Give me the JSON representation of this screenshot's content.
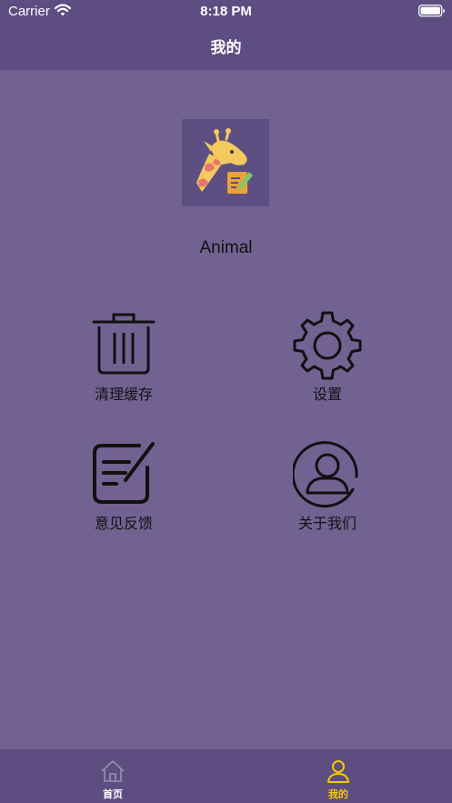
{
  "status_bar": {
    "carrier": "Carrier",
    "time": "8:18 PM"
  },
  "nav": {
    "title": "我的"
  },
  "profile": {
    "username": "Animal",
    "avatar_icon": "giraffe-notepad-icon"
  },
  "menu": [
    {
      "label": "清理缓存",
      "icon": "trash-icon"
    },
    {
      "label": "设置",
      "icon": "gear-icon"
    },
    {
      "label": "意见反馈",
      "icon": "feedback-edit-icon"
    },
    {
      "label": "关于我们",
      "icon": "user-circle-icon"
    }
  ],
  "tabbar": {
    "tabs": [
      {
        "label": "首页",
        "icon": "home-icon",
        "active": false
      },
      {
        "label": "我的",
        "icon": "person-icon",
        "active": true
      }
    ]
  },
  "colors": {
    "background": "#726291",
    "bars": "#5d4d80",
    "tab_active": "#f5c800",
    "tab_inactive": "#ffffff"
  }
}
